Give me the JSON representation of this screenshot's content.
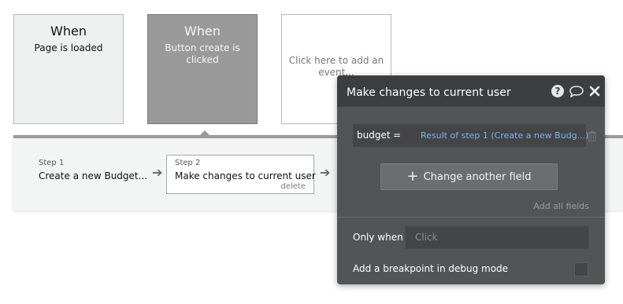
{
  "events": [
    {
      "title": "When",
      "subtitle": "Page is loaded"
    },
    {
      "title": "When",
      "subtitle": "Button create is clicked"
    },
    {
      "subtitle": "Click here to add an event..."
    }
  ],
  "workflow": {
    "steps": [
      {
        "num": "Step 1",
        "name": "Create a new Budget..."
      },
      {
        "num": "Step 2",
        "name": "Make changes to current user",
        "delete_label": "delete"
      }
    ]
  },
  "panel": {
    "title": "Make changes to current user",
    "icons": [
      "help-icon",
      "comment-icon",
      "close-icon"
    ],
    "field": {
      "name": "budget",
      "eq": "=",
      "value": "Result of step 1 (Create a new Budg...)"
    },
    "change_button": "Change another field",
    "add_all_fields": "Add all fields",
    "only_when_label": "Only when",
    "only_when_placeholder": "Click",
    "breakpoint_label": "Add a breakpoint in debug mode"
  },
  "colors": {
    "panel_bg": "#525455",
    "panel_header": "#3c3e3f",
    "link_blue": "#7cb4f0",
    "selected_event": "#999999"
  }
}
